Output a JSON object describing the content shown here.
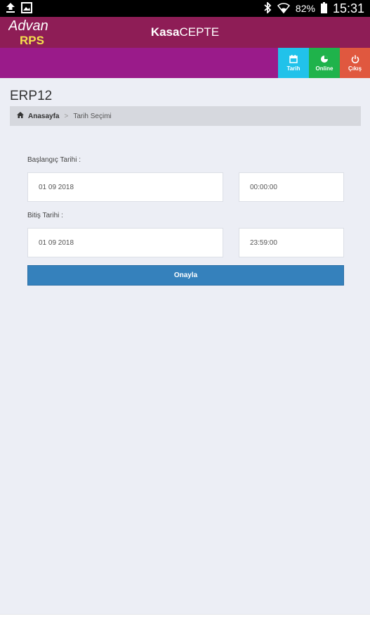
{
  "status_bar": {
    "battery": "82%",
    "time": "15:31"
  },
  "header": {
    "logo_top": "Advan",
    "logo_bottom": "RPS",
    "title_bold": "Kasa",
    "title_rest": "CEPTE"
  },
  "toolbar": {
    "date_label": "Tarih",
    "online_label": "Online",
    "exit_label": "Çıkış",
    "colors": {
      "bar": "#9a1b8a",
      "date": "#21c2ea",
      "online": "#1fb34b",
      "exit": "#e0583f"
    }
  },
  "page": {
    "title": "ERP12",
    "breadcrumb_home": "Anasayfa",
    "breadcrumb_sep": ">",
    "breadcrumb_current": "Tarih Seçimi"
  },
  "form": {
    "start_label": "Başlangıç Tarihi :",
    "start_date": "01 09 2018",
    "start_time": "00:00:00",
    "end_label": "Bitiş Tarihi :",
    "end_date": "01 09 2018",
    "end_time": "23:59:00",
    "confirm_label": "Onayla"
  }
}
